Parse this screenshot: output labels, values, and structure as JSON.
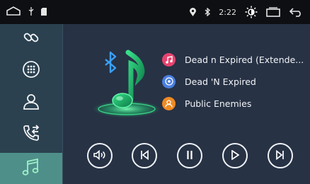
{
  "status_bar": {
    "time": "2:22",
    "icons": [
      "home-outline-icon",
      "usb-icon",
      "sd-card-icon",
      "location-pin-icon",
      "bluetooth-icon",
      "brightness-icon",
      "recent-apps-icon",
      "back-arrow-icon"
    ]
  },
  "sidebar": {
    "items": [
      {
        "icon": "link-icon",
        "active": false
      },
      {
        "icon": "dialpad-icon",
        "active": false
      },
      {
        "icon": "contacts-icon",
        "active": false
      },
      {
        "icon": "call-log-icon",
        "active": false
      },
      {
        "icon": "bluetooth-music-icon",
        "active": true
      }
    ]
  },
  "tracks": [
    {
      "icon": "music-note-icon",
      "color": "#e8436f",
      "text": "Dead n Expired (Extende..."
    },
    {
      "icon": "album-disc-icon",
      "color": "#4a7fe0",
      "text": "Dead 'N Expired"
    },
    {
      "icon": "artist-person-icon",
      "color": "#f08a23",
      "text": "Public Enemies"
    }
  ],
  "controls": [
    "volume-icon",
    "previous-track-icon",
    "pause-icon",
    "play-icon",
    "next-track-icon"
  ],
  "colors": {
    "accent": "#4f8f8a",
    "art_glow": "#35e08a",
    "bluetooth": "#3aa0ff"
  }
}
